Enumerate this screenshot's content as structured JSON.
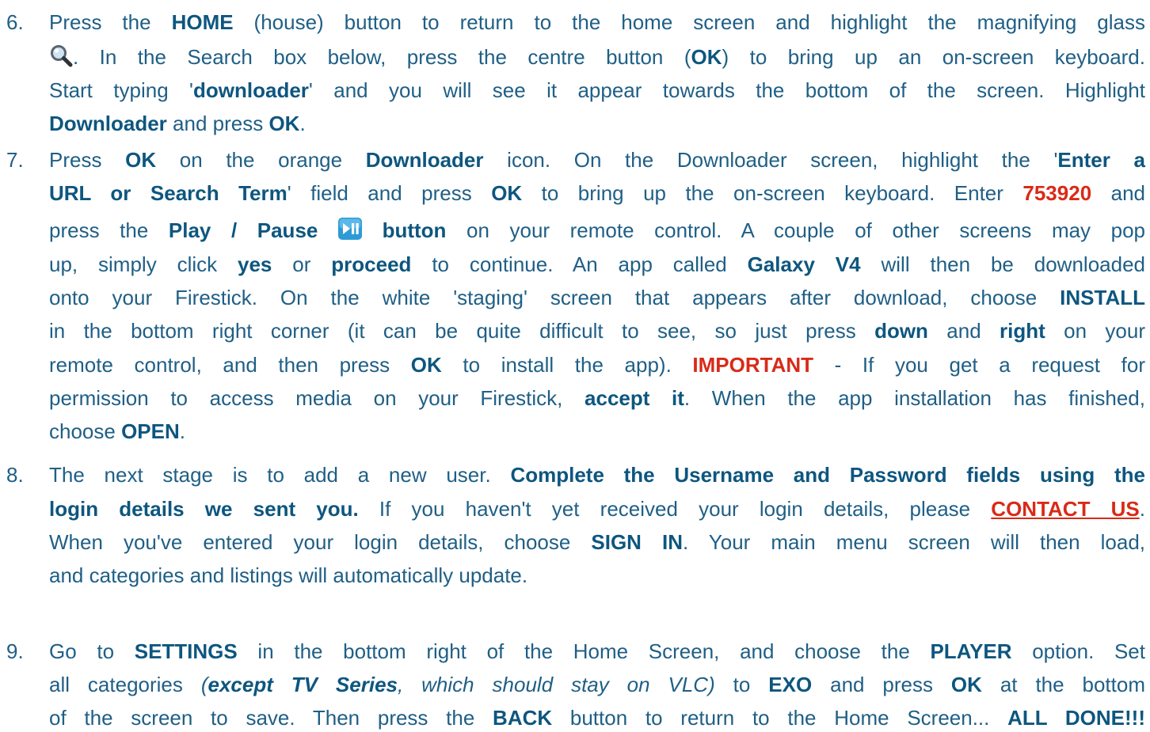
{
  "steps": [
    {
      "number": "6.",
      "lines": [
        {
          "segments": [
            {
              "t": "Press the ",
              "s": ""
            },
            {
              "t": "HOME",
              "s": "b"
            },
            {
              "t": " (house) button to return to the home screen and highlight the magnifying glass",
              "s": ""
            }
          ]
        },
        {
          "segments": [
            {
              "icon": "magnifying-glass-icon"
            },
            {
              "t": ". In the Search box below, press the centre button (",
              "s": ""
            },
            {
              "t": "OK",
              "s": "b"
            },
            {
              "t": ") to bring up an on-screen keyboard.",
              "s": ""
            }
          ]
        },
        {
          "segments": [
            {
              "t": "Start typing '",
              "s": ""
            },
            {
              "t": "downloader",
              "s": "b"
            },
            {
              "t": "' and you will see it appear towards the bottom of the screen. Highlight",
              "s": ""
            }
          ]
        },
        {
          "last": true,
          "segments": [
            {
              "t": "Downloader",
              "s": "b"
            },
            {
              "t": " and press ",
              "s": ""
            },
            {
              "t": "OK",
              "s": "b"
            },
            {
              "t": ".",
              "s": ""
            }
          ]
        }
      ]
    },
    {
      "number": "7.",
      "lines": [
        {
          "segments": [
            {
              "t": "Press ",
              "s": ""
            },
            {
              "t": "OK",
              "s": "b"
            },
            {
              "t": " on the orange ",
              "s": ""
            },
            {
              "t": "Downloader",
              "s": "b"
            },
            {
              "t": " icon. On the Downloader screen, highlight the '",
              "s": ""
            },
            {
              "t": "Enter a",
              "s": "b"
            }
          ]
        },
        {
          "segments": [
            {
              "t": "URL or Search Term",
              "s": "b"
            },
            {
              "t": "' field and press ",
              "s": ""
            },
            {
              "t": "OK",
              "s": "b"
            },
            {
              "t": " to bring up the on-screen keyboard. Enter ",
              "s": ""
            },
            {
              "t": "753920",
              "s": "red"
            },
            {
              "t": " and",
              "s": ""
            }
          ]
        },
        {
          "segments": [
            {
              "t": "press the ",
              "s": ""
            },
            {
              "t": "Play / Pause",
              "s": "b"
            },
            {
              "t": " ",
              "s": ""
            },
            {
              "icon": "play-pause-icon"
            },
            {
              "t": " ",
              "s": ""
            },
            {
              "t": "button",
              "s": "b"
            },
            {
              "t": " on your remote control. A couple of other screens may pop",
              "s": ""
            }
          ]
        },
        {
          "segments": [
            {
              "t": "up, simply click ",
              "s": ""
            },
            {
              "t": "yes",
              "s": "b"
            },
            {
              "t": " or ",
              "s": ""
            },
            {
              "t": "proceed",
              "s": "b"
            },
            {
              "t": " to continue. An app called ",
              "s": ""
            },
            {
              "t": "Galaxy V4",
              "s": "b"
            },
            {
              "t": " will then be downloaded",
              "s": ""
            }
          ]
        },
        {
          "segments": [
            {
              "t": "onto your Firestick. On the white 'staging' screen that appears after download, choose ",
              "s": ""
            },
            {
              "t": "INSTALL",
              "s": "b"
            }
          ]
        },
        {
          "segments": [
            {
              "t": "in the bottom right corner (it can be quite difficult to see, so just press ",
              "s": ""
            },
            {
              "t": "down",
              "s": "b"
            },
            {
              "t": " and ",
              "s": ""
            },
            {
              "t": "right",
              "s": "b"
            },
            {
              "t": " on your",
              "s": ""
            }
          ]
        },
        {
          "segments": [
            {
              "t": "remote control, and then press ",
              "s": ""
            },
            {
              "t": "OK",
              "s": "b"
            },
            {
              "t": " to install the app). ",
              "s": ""
            },
            {
              "t": "IMPORTANT",
              "s": "red"
            },
            {
              "t": " - If you get a request for",
              "s": ""
            }
          ]
        },
        {
          "segments": [
            {
              "t": "permission to access media on your Firestick, ",
              "s": ""
            },
            {
              "t": "accept it",
              "s": "b"
            },
            {
              "t": ". When the app installation has finished,",
              "s": ""
            }
          ]
        },
        {
          "last": true,
          "segments": [
            {
              "t": "choose ",
              "s": ""
            },
            {
              "t": "OPEN",
              "s": "b"
            },
            {
              "t": ".",
              "s": ""
            }
          ]
        }
      ]
    },
    {
      "number": "8.",
      "lines": [
        {
          "segments": [
            {
              "t": "The next stage is to add a new user. ",
              "s": ""
            },
            {
              "t": "Complete the Username and Password fields using the",
              "s": "b"
            }
          ]
        },
        {
          "segments": [
            {
              "t": "login details we sent you.",
              "s": "b"
            },
            {
              "t": " If you haven't yet received your login details, please ",
              "s": ""
            },
            {
              "t": "CONTACT US",
              "s": "link"
            },
            {
              "t": ".",
              "s": ""
            }
          ]
        },
        {
          "segments": [
            {
              "t": "When you've entered your login details, choose ",
              "s": ""
            },
            {
              "t": "SIGN IN",
              "s": "b"
            },
            {
              "t": ". Your main menu screen will then load,",
              "s": ""
            }
          ]
        },
        {
          "last": true,
          "segments": [
            {
              "t": "and categories and listings will automatically update.",
              "s": ""
            }
          ]
        }
      ]
    },
    {
      "number": "9.",
      "lines": [
        {
          "segments": [
            {
              "t": "Go to ",
              "s": ""
            },
            {
              "t": "SETTINGS",
              "s": "b"
            },
            {
              "t": " in the bottom right of the Home Screen, and choose the ",
              "s": ""
            },
            {
              "t": "PLAYER",
              "s": "b"
            },
            {
              "t": " option. Set",
              "s": ""
            }
          ]
        },
        {
          "segments": [
            {
              "t": "all categories ",
              "s": ""
            },
            {
              "t": "(",
              "s": "it"
            },
            {
              "t": "except TV Series",
              "s": "b it"
            },
            {
              "t": ", which should stay on VLC)",
              "s": "it"
            },
            {
              "t": " to ",
              "s": ""
            },
            {
              "t": "EXO",
              "s": "b"
            },
            {
              "t": " and press ",
              "s": ""
            },
            {
              "t": "OK",
              "s": "b"
            },
            {
              "t": " at the bottom",
              "s": ""
            }
          ]
        },
        {
          "segments": [
            {
              "t": "of the screen to save. Then press the ",
              "s": ""
            },
            {
              "t": "BACK",
              "s": "b"
            },
            {
              "t": " button to return to the Home Screen... ",
              "s": ""
            },
            {
              "t": "ALL DONE!!!",
              "s": "b"
            }
          ]
        }
      ]
    }
  ],
  "colors": {
    "body_text": "#1f5f86",
    "emphasis": "#0d567f",
    "alert_red": "#d92a17"
  }
}
